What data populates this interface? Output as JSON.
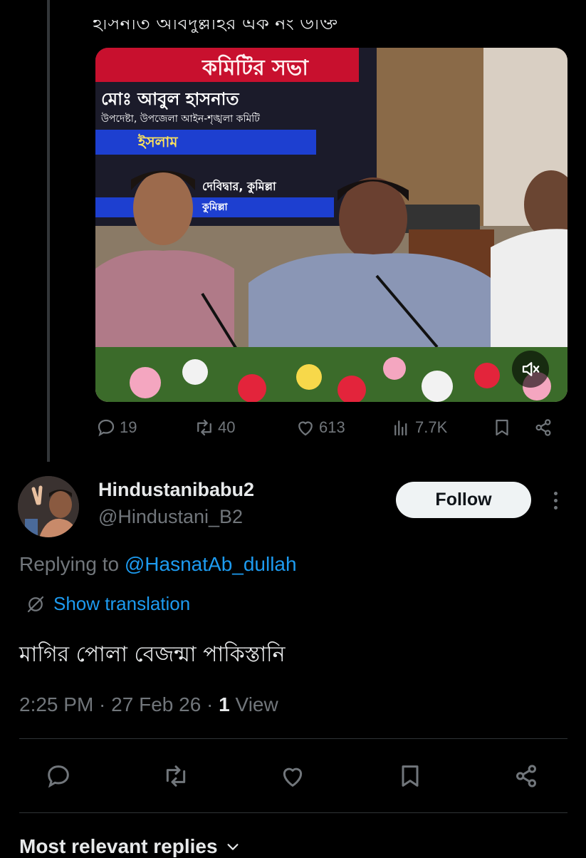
{
  "parent_tweet": {
    "cut_text": "হাসনাত আবদুল্লাহর এক নং উক্তি",
    "media": {
      "banner_title": "কমিটির সভা",
      "line1": "মোঃ আবুল হাসনাত",
      "line2": "উপদেষ্টা, উপজেলা আইন-শৃঙ্খলা কমিটি",
      "line3": "ইসলাম",
      "line4": "দেবিদ্বার, কুমিল্লা",
      "line5": "কুমিল্লা",
      "mute_icon": "speaker-muted-icon"
    },
    "stats": {
      "replies": "19",
      "reposts": "40",
      "likes": "613",
      "views": "7.7K"
    }
  },
  "reply": {
    "display_name": "Hindustanibabu2",
    "handle": "@Hindustani_B2",
    "follow_label": "Follow",
    "replying_prefix": "Replying to",
    "replying_handle": "@HasnatAb_dullah",
    "translate_label": "Show translation",
    "text": "মাগির পোলা বেজন্মা পাকিস্তানি",
    "time": "2:25 PM",
    "date": "27 Feb 26",
    "view_count": "1",
    "view_label": "View"
  },
  "replies_sort": {
    "label": "Most relevant replies"
  },
  "colors": {
    "background": "#000000",
    "text": "#e7e9ea",
    "muted": "#71767b",
    "accent": "#1d9bf0",
    "divider": "#2f3336"
  }
}
